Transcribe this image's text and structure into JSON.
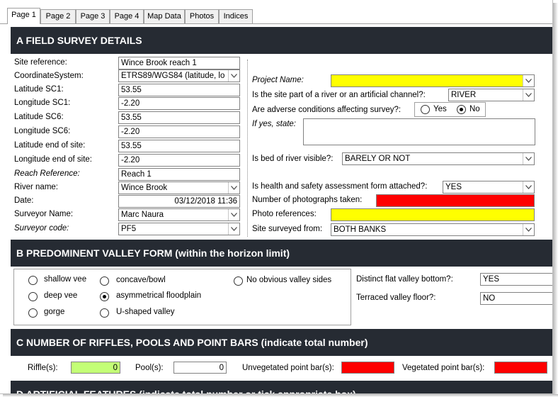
{
  "tabs": [
    "Page 1",
    "Page 2",
    "Page 3",
    "Page 4",
    "Map Data",
    "Photos",
    "Indices"
  ],
  "active_tab": "Page 1",
  "section_a": {
    "title": "A  FIELD SURVEY DETAILS",
    "left": {
      "site_reference": {
        "label": "Site reference:",
        "value": "Wince Brook reach 1"
      },
      "coordinate_system": {
        "label": "CoordinateSystem:",
        "value": "ETRS89/WGS84 (latitude, lo"
      },
      "lat_sc1": {
        "label": "Latitude SC1:",
        "value": "53.55"
      },
      "lon_sc1": {
        "label": "Longitude SC1:",
        "value": "-2.20"
      },
      "lat_sc6": {
        "label": "Latitude SC6:",
        "value": "53.55"
      },
      "lon_sc6": {
        "label": "Longitude SC6:",
        "value": "-2.20"
      },
      "lat_end": {
        "label": "Latitude end of site:",
        "value": "53.55"
      },
      "lon_end": {
        "label": "Longitude end of site:",
        "value": "-2.20"
      },
      "reach_reference": {
        "label": "Reach Reference:",
        "value": "Reach 1"
      },
      "river_name": {
        "label": "River name:",
        "value": "Wince Brook"
      },
      "date": {
        "label": "Date:",
        "value": "03/12/2018 11:36"
      },
      "surveyor_name": {
        "label": "Surveyor Name:",
        "value": "Marc Naura"
      },
      "surveyor_code": {
        "label": "Surveyor code:",
        "value": "PF5"
      }
    },
    "right": {
      "project_name": {
        "label": "Project Name:",
        "value": ""
      },
      "site_part": {
        "label": "Is the site part of a river or an artificial channel?:",
        "value": "RIVER"
      },
      "adverse": {
        "label": "Are adverse conditions affecting survey?:",
        "yes": "Yes",
        "no": "No",
        "selected": "No"
      },
      "if_yes": {
        "label": "If yes, state:",
        "value": ""
      },
      "bed_visible": {
        "label": "Is bed of river visible?:",
        "value": "BARELY OR NOT"
      },
      "health_safety": {
        "label": "Is health and safety assessment form attached?:",
        "value": "YES"
      },
      "num_photos": {
        "label": "Number of photographs taken:",
        "value": ""
      },
      "photo_refs": {
        "label": "Photo references:",
        "value": ""
      },
      "surveyed_from": {
        "label": "Site surveyed from:",
        "value": "BOTH BANKS"
      }
    }
  },
  "section_b": {
    "title": "B  PREDOMINENT VALLEY FORM (within the horizon limit)",
    "options": [
      "shallow vee",
      "deep vee",
      "gorge",
      "concave/bowl",
      "asymmetrical floodplain",
      "U-shaped valley",
      "No obvious valley sides"
    ],
    "selected": "asymmetrical floodplain",
    "flat_bottom": {
      "label": "Distinct flat valley bottom?:",
      "value": "YES"
    },
    "terraced": {
      "label": "Terraced valley floor?:",
      "value": "NO"
    }
  },
  "section_c": {
    "title": "C  NUMBER OF RIFFLES, POOLS AND POINT BARS (indicate total number)",
    "riffles": {
      "label": "Riffle(s):",
      "value": "0"
    },
    "pools": {
      "label": "Pool(s):",
      "value": "0"
    },
    "unveg": {
      "label": "Unvegetated point bar(s):",
      "value": ""
    },
    "veg": {
      "label": "Vegetated point bar(s):",
      "value": ""
    }
  },
  "section_d": {
    "title": "D  ARTIFICIAL FEATURES (indicate total number or tick appropriate box)"
  },
  "colors": {
    "header_bg": "#262b33",
    "required_yellow": "#ffff00",
    "required_red": "#ff0000",
    "riffle_green": "#c3ff76"
  }
}
